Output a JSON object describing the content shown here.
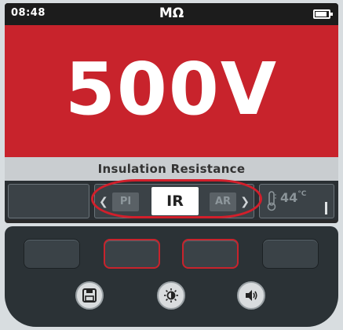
{
  "status": {
    "time": "08:48",
    "unit": "MΩ",
    "battery_level": 0.85
  },
  "reading": {
    "voltage": "500V"
  },
  "mode": {
    "label": "Insulation Resistance",
    "tabs": [
      {
        "label": "PI",
        "active": false
      },
      {
        "label": "IR",
        "active": true
      },
      {
        "label": "AR",
        "active": false
      }
    ]
  },
  "temperature": {
    "value": "44",
    "unit": "°C"
  },
  "colors": {
    "accent": "#c8232c",
    "background": "#d8dde0",
    "keypad": "#2b3236"
  },
  "keypad": {
    "soft_keys": 4,
    "icons": [
      "save-icon",
      "brightness-icon",
      "volume-icon"
    ]
  }
}
